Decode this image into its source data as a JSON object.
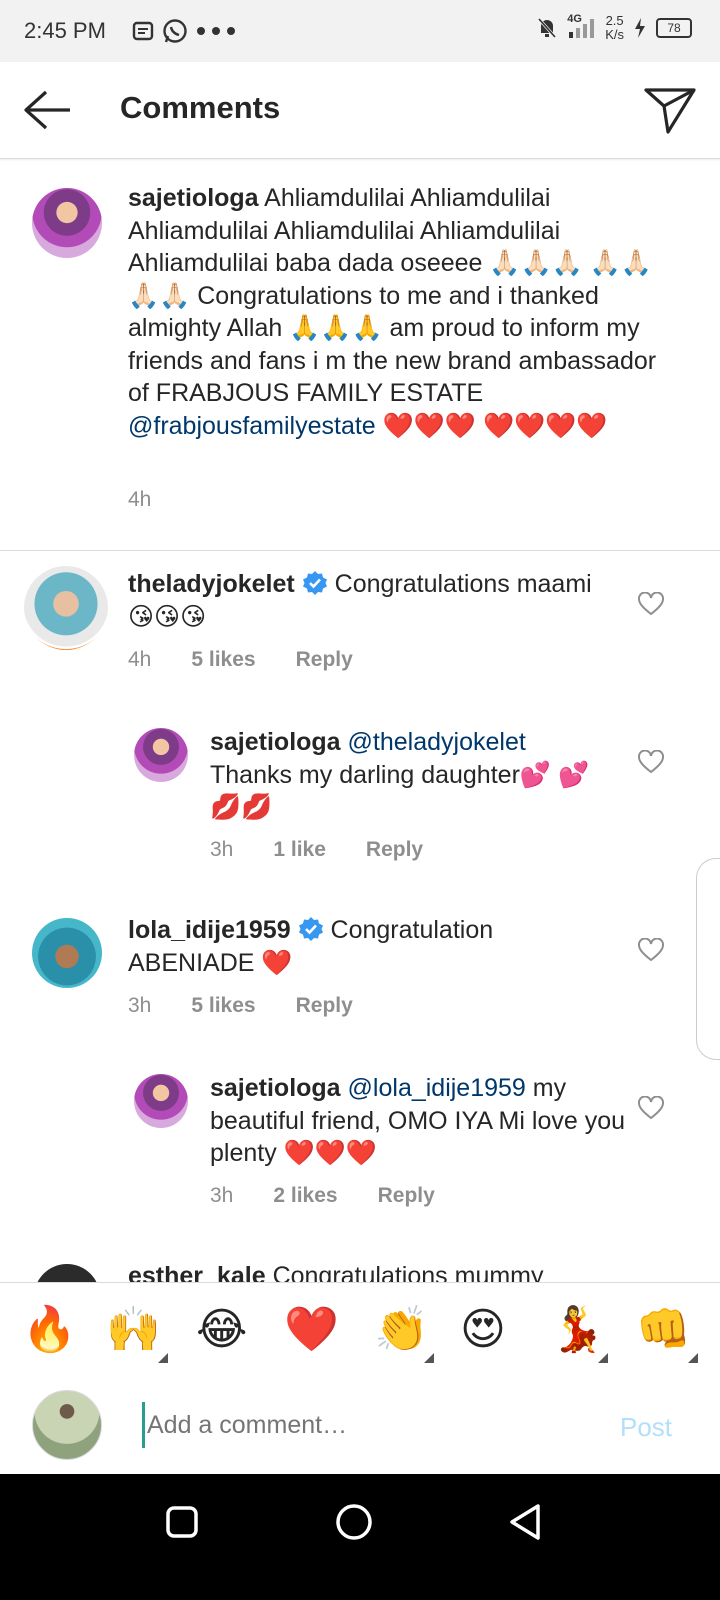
{
  "status_bar": {
    "time": "2:45 PM",
    "network": "4G",
    "speed": "2.5",
    "speed_unit": "K/s",
    "battery": "78"
  },
  "header": {
    "title": "Comments"
  },
  "caption": {
    "username": "sajetiologa",
    "text": "Ahliamdulilai  Ahliamdulilai Ahliamdulilai Ahliamdulilai Ahliamdulilai Ahliamdulilai  baba dada oseeee 🙏🏻🙏🏻🙏🏻 🙏🏻🙏🏻🙏🏻🙏🏻 Congratulations to me and i thanked almighty Allah 🙏🙏🙏 am proud to inform my friends and fans i m the new brand ambassador of FRABJOUS FAMILY ESTATE",
    "mention": "@frabjousfamilyestate",
    "trailing": "❤️❤️❤️ ❤️❤️❤️❤️",
    "time": "4h"
  },
  "comments": [
    {
      "username": "theladyjokelet",
      "text": "Congratulations maami 😘😘😘",
      "time": "4h",
      "likes": "5 likes",
      "reply": "Reply"
    },
    {
      "username": "sajetiologa",
      "mention": "@theladyjokelet",
      "text": "Thanks my darling daughter💕 💕💋💋",
      "time": "3h",
      "likes": "1 like",
      "reply": "Reply"
    },
    {
      "username": "lola_idije1959",
      "text": "Congratulation ABENIADE ❤️",
      "time": "3h",
      "likes": "5 likes",
      "reply": "Reply"
    },
    {
      "username": "sajetiologa",
      "mention": "@lola_idije1959",
      "text": "my beautiful friend, OMO IYA Mi love you plenty ❤️❤️❤️",
      "time": "3h",
      "likes": "2 likes",
      "reply": "Reply"
    },
    {
      "username": "esther_kale",
      "text": "Congratulations mummy"
    }
  ],
  "emoji_bar": [
    "🔥",
    "🙌",
    "😂",
    "❤️",
    "👏",
    "😍",
    "💃",
    "👊"
  ],
  "composer": {
    "placeholder": "Add a comment…",
    "post_label": "Post"
  }
}
